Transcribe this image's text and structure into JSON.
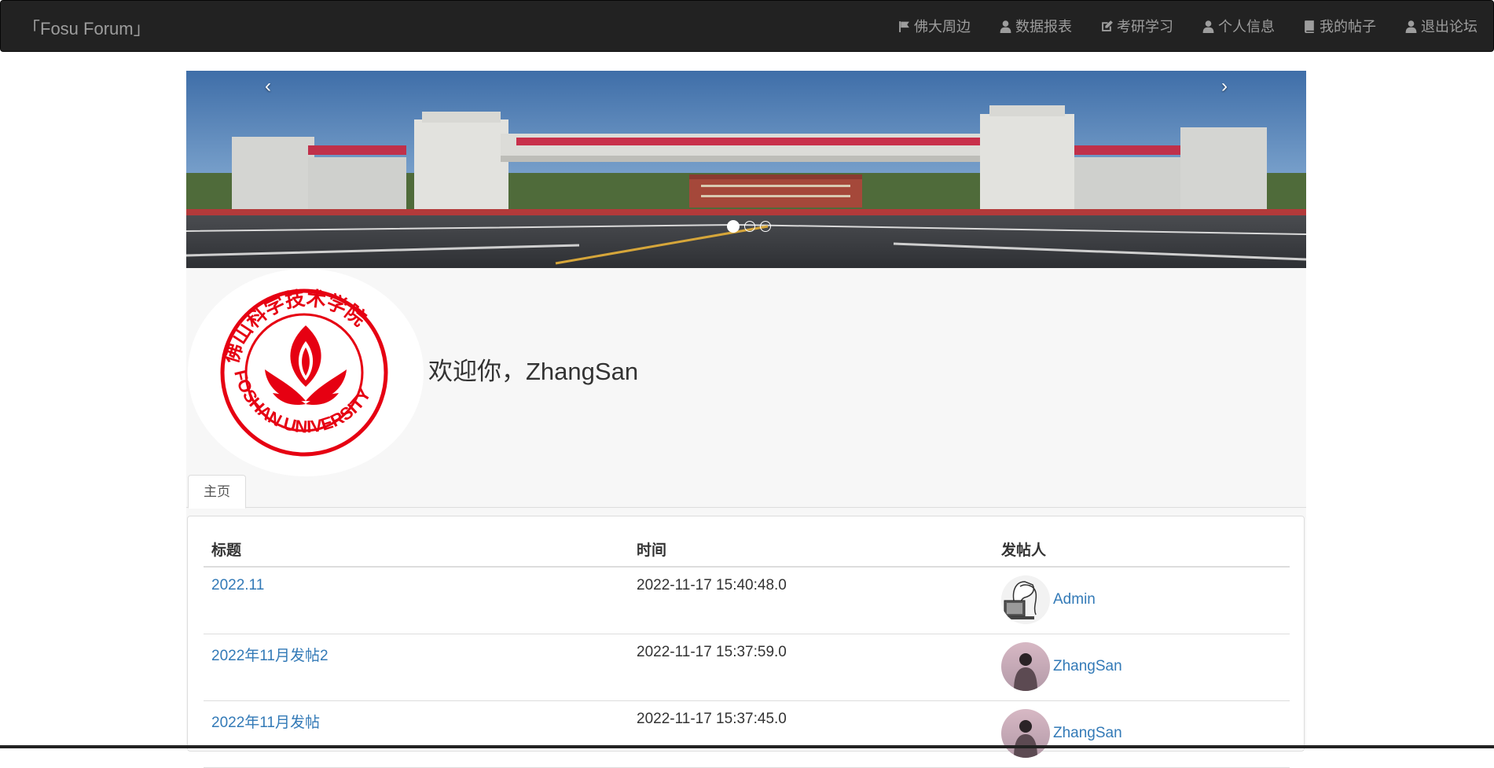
{
  "navbar": {
    "brand": "「Fosu Forum」",
    "items": [
      {
        "label": "佛大周边",
        "icon": "flag-icon"
      },
      {
        "label": "数据报表",
        "icon": "user-icon"
      },
      {
        "label": "考研学习",
        "icon": "edit-icon"
      },
      {
        "label": "个人信息",
        "icon": "user-icon"
      },
      {
        "label": "我的帖子",
        "icon": "book-icon"
      },
      {
        "label": "退出论坛",
        "icon": "user-icon"
      }
    ]
  },
  "carousel": {
    "prev": "‹",
    "next": "›",
    "slide_count": 3,
    "active_index": 0
  },
  "profile": {
    "welcome": "欢迎你，ZhangSan",
    "logo_text_top": "佛山科学技术学院",
    "logo_text_bottom": "FOSHAN UNIVERSITY"
  },
  "tabs": [
    {
      "label": "主页"
    }
  ],
  "table": {
    "headers": [
      "标题",
      "时间",
      "发帖人"
    ],
    "rows": [
      {
        "title": "2022.11",
        "time": "2022-11-17 15:40:48.0",
        "author": "Admin"
      },
      {
        "title": "2022年11月发帖2",
        "time": "2022-11-17 15:37:59.0",
        "author": "ZhangSan"
      },
      {
        "title": "2022年11月发帖",
        "time": "2022-11-17 15:37:45.0",
        "author": "ZhangSan"
      }
    ]
  },
  "colors": {
    "navbar_bg": "#222222",
    "nav_text": "#9d9d9d",
    "link": "#337ab7",
    "logo_red": "#e60012"
  }
}
